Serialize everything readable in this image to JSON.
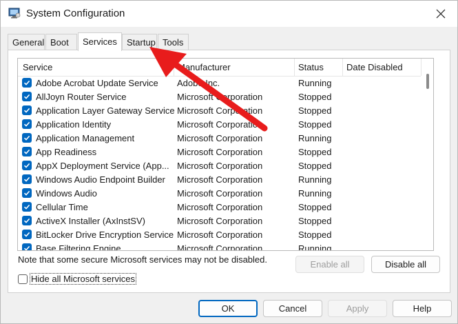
{
  "window": {
    "title": "System Configuration"
  },
  "tabs": [
    {
      "label": "General"
    },
    {
      "label": "Boot"
    },
    {
      "label": "Services"
    },
    {
      "label": "Startup"
    },
    {
      "label": "Tools"
    }
  ],
  "table": {
    "columns": [
      "Service",
      "Manufacturer",
      "Status",
      "Date Disabled"
    ],
    "rows": [
      {
        "service": "Adobe Acrobat Update Service",
        "manufacturer": "Adobe Inc.",
        "status": "Running"
      },
      {
        "service": "AllJoyn Router Service",
        "manufacturer": "Microsoft Corporation",
        "status": "Stopped"
      },
      {
        "service": "Application Layer Gateway Service",
        "manufacturer": "Microsoft Corporation",
        "status": "Stopped"
      },
      {
        "service": "Application Identity",
        "manufacturer": "Microsoft Corporation",
        "status": "Stopped"
      },
      {
        "service": "Application Management",
        "manufacturer": "Microsoft Corporation",
        "status": "Running"
      },
      {
        "service": "App Readiness",
        "manufacturer": "Microsoft Corporation",
        "status": "Stopped"
      },
      {
        "service": "AppX Deployment Service (App...",
        "manufacturer": "Microsoft Corporation",
        "status": "Stopped"
      },
      {
        "service": "Windows Audio Endpoint Builder",
        "manufacturer": "Microsoft Corporation",
        "status": "Running"
      },
      {
        "service": "Windows Audio",
        "manufacturer": "Microsoft Corporation",
        "status": "Running"
      },
      {
        "service": "Cellular Time",
        "manufacturer": "Microsoft Corporation",
        "status": "Stopped"
      },
      {
        "service": "ActiveX Installer (AxInstSV)",
        "manufacturer": "Microsoft Corporation",
        "status": "Stopped"
      },
      {
        "service": "BitLocker Drive Encryption Service",
        "manufacturer": "Microsoft Corporation",
        "status": "Stopped"
      },
      {
        "service": "Base Filtering Engine",
        "manufacturer": "Microsoft Corporation",
        "status": "Running"
      }
    ]
  },
  "note": "Note that some secure Microsoft services may not be disabled.",
  "buttons": {
    "enable_all": "Enable all",
    "disable_all": "Disable all",
    "ok": "OK",
    "cancel": "Cancel",
    "apply": "Apply",
    "help": "Help"
  },
  "hide_ms": {
    "label": "Hide all Microsoft services"
  },
  "colors": {
    "accent": "#0067c0",
    "annotation_arrow": "#e81c1c"
  }
}
